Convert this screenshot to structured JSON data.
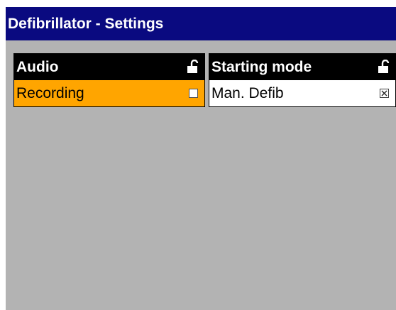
{
  "window": {
    "title": "Defibrillator - Settings"
  },
  "colors": {
    "titlebar": "#0a0a80",
    "background": "#b3b3b3",
    "selected_row": "#ffa500",
    "panel_header": "#000000"
  },
  "panels": [
    {
      "header": "Audio",
      "lock_icon": "unlocked-padlock-icon",
      "rows": [
        {
          "label": "Recording",
          "checked": false,
          "selected": true
        }
      ]
    },
    {
      "header": "Starting mode",
      "lock_icon": "unlocked-padlock-icon",
      "rows": [
        {
          "label": "Man. Defib",
          "checked": true,
          "selected": false
        }
      ]
    }
  ]
}
